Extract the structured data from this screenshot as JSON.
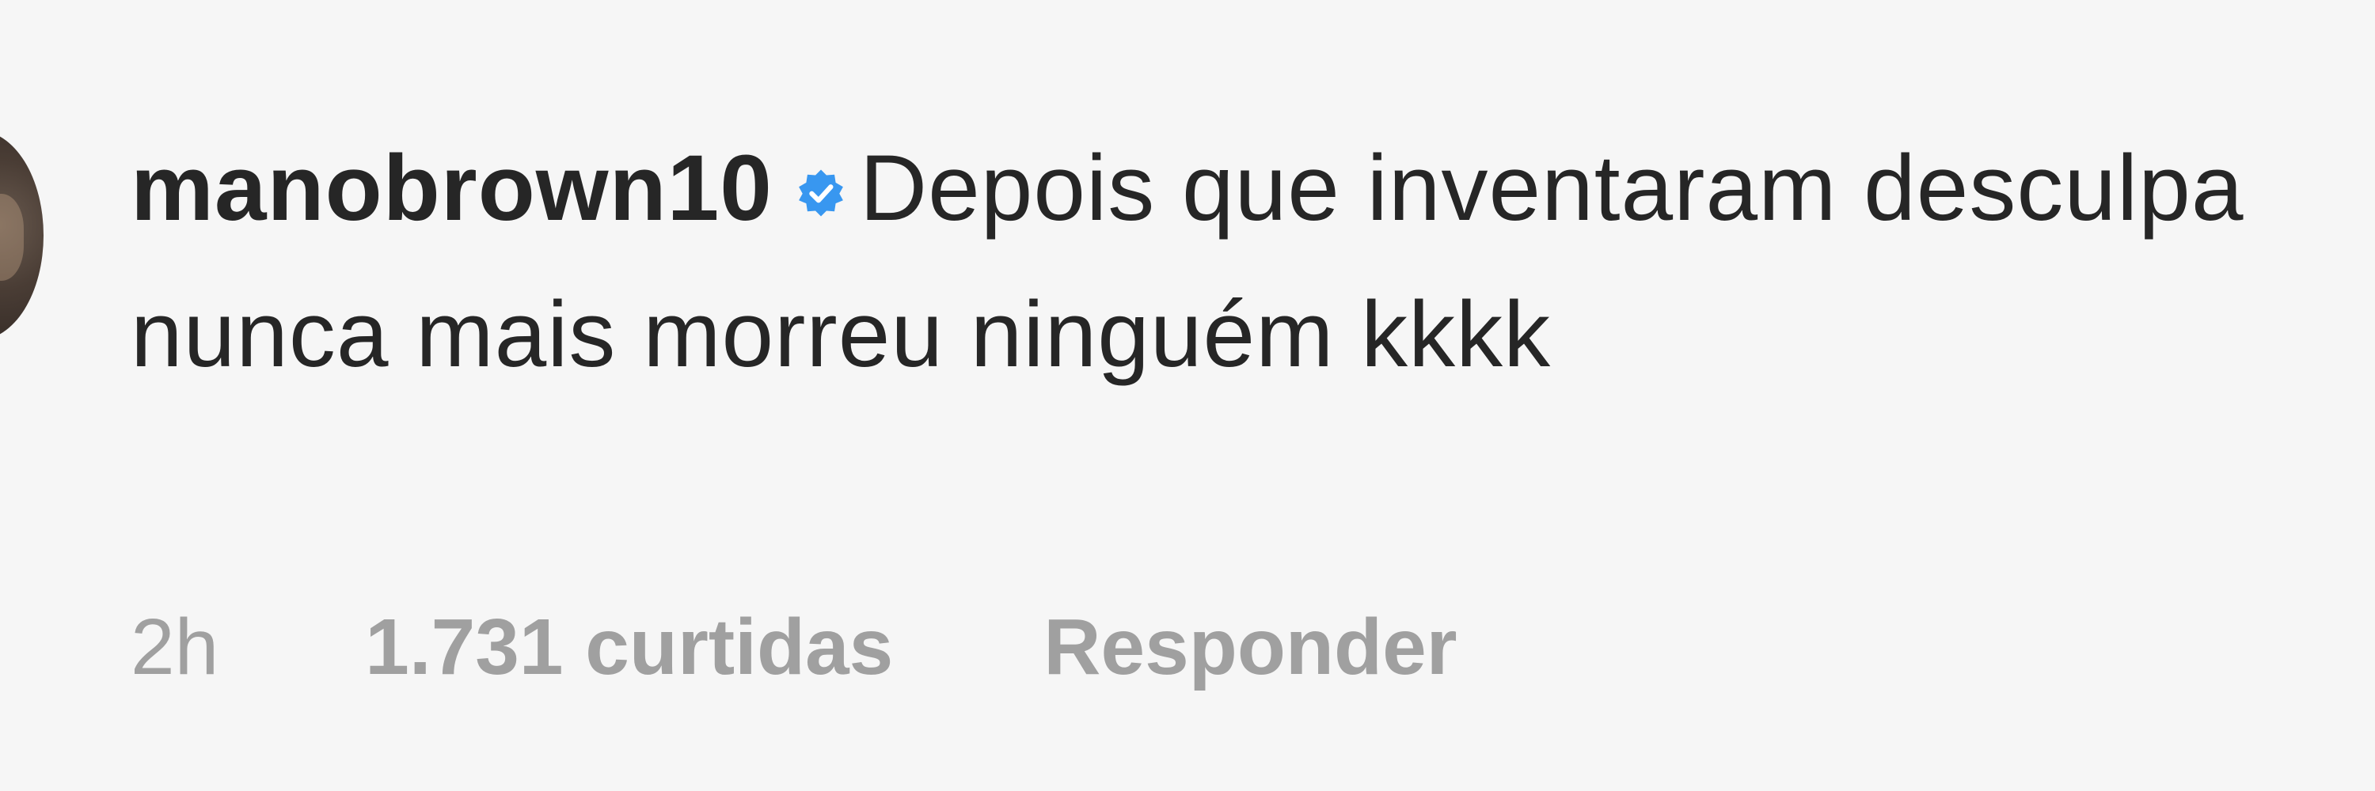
{
  "comment": {
    "username": "manobrown10",
    "verified_icon": "verified-badge-icon",
    "text": "Depois que inventaram desculpa nunca mais morreu ninguém kkkk",
    "time": "2h",
    "likes": "1.731 curtidas",
    "reply_label": "Responder"
  },
  "colors": {
    "background": "#f6f6f6",
    "text": "#262626",
    "meta": "#a0a0a0",
    "verified": "#3897f0"
  }
}
